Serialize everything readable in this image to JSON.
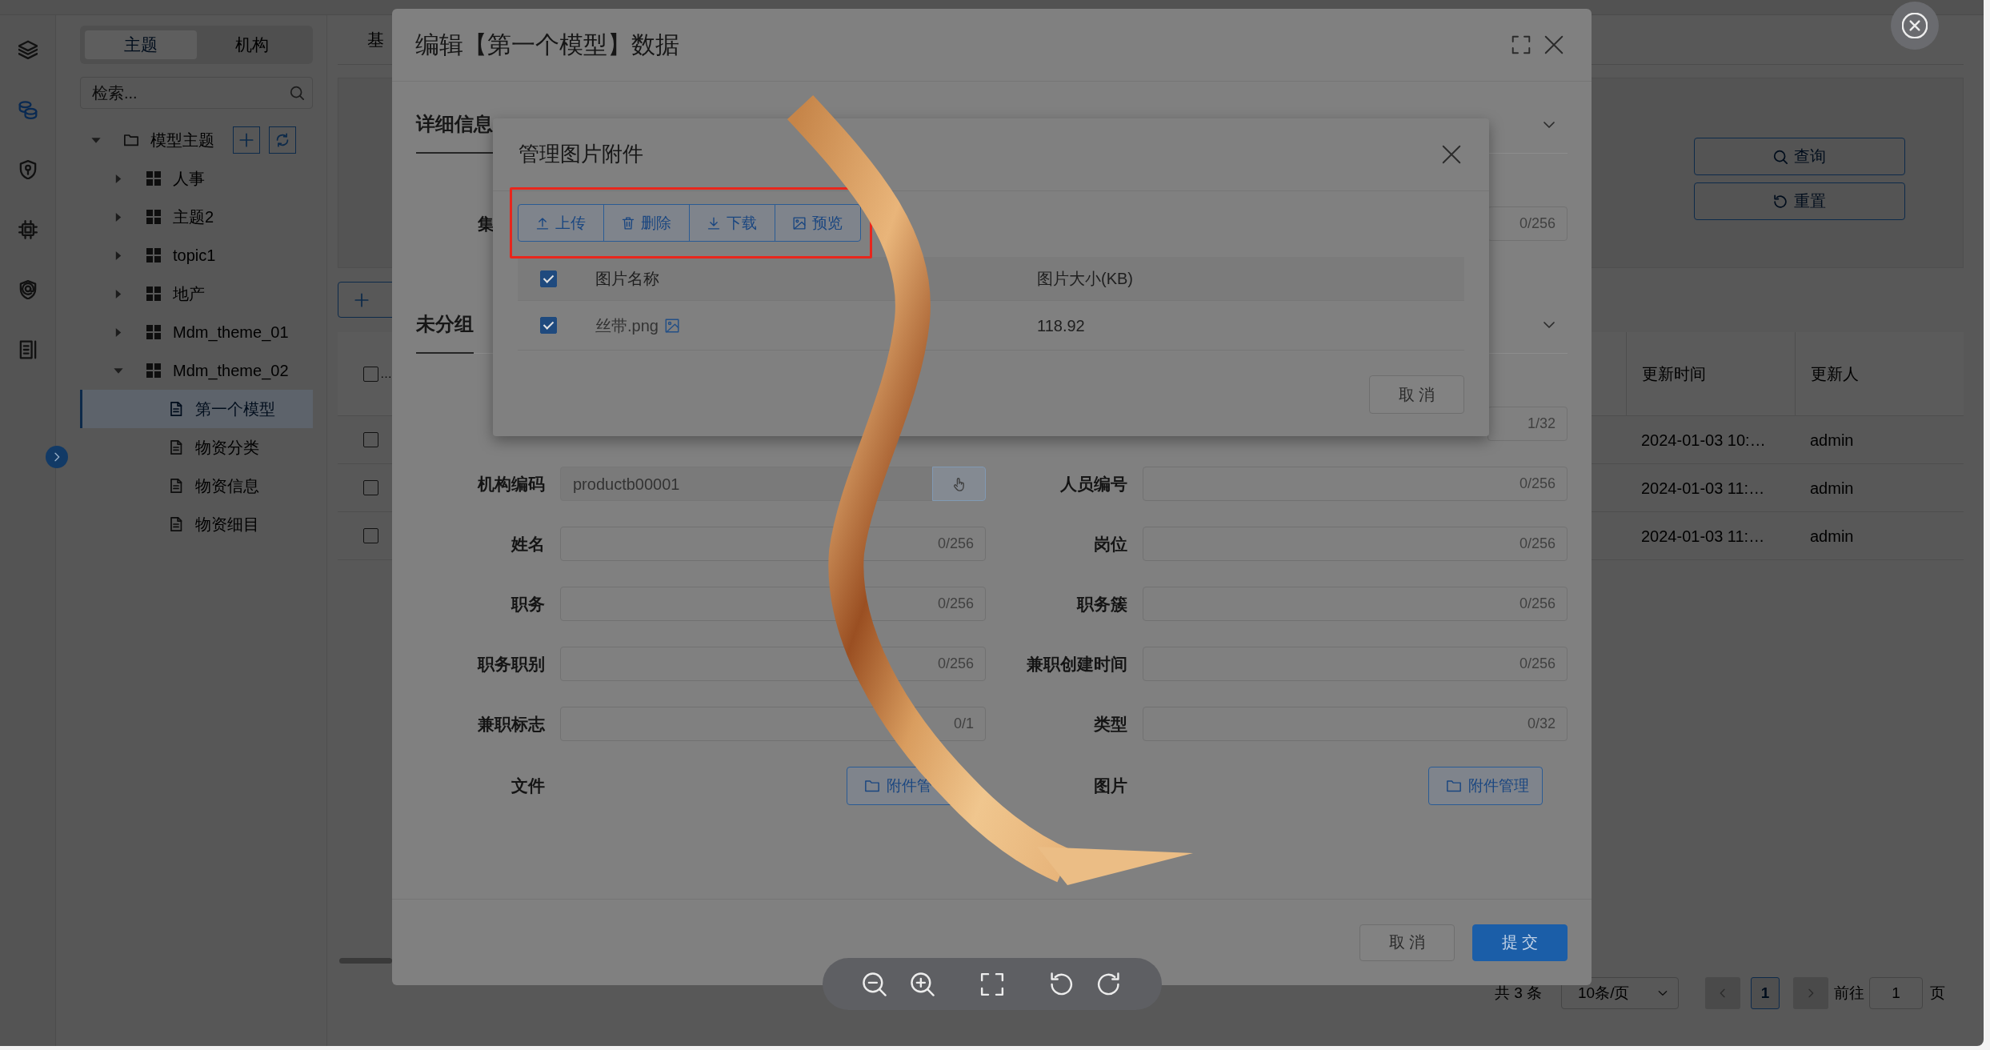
{
  "nav_rail": {
    "items": [
      {
        "selected": false
      },
      {
        "selected": true
      },
      {
        "selected": false
      },
      {
        "selected": false
      },
      {
        "selected": false
      },
      {
        "selected": false
      }
    ]
  },
  "sidebar": {
    "tabs": [
      {
        "label": "主题",
        "selected": true
      },
      {
        "label": "机构",
        "selected": false
      }
    ],
    "search": {
      "placeholder": "检索..."
    },
    "tree": [
      {
        "label": "模型主题",
        "selected": false,
        "expanded": true,
        "children": [
          {
            "label": "人事",
            "selected": false,
            "expanded": false
          },
          {
            "label": "主题2",
            "selected": false,
            "expanded": false
          },
          {
            "label": "topic1",
            "selected": false,
            "expanded": false
          },
          {
            "label": "地产",
            "selected": false,
            "expanded": false
          },
          {
            "label": "Mdm_theme_01",
            "selected": false,
            "expanded": false
          },
          {
            "label": "Mdm_theme_02",
            "selected": false,
            "expanded": true,
            "children": [
              {
                "label": "第一个模型",
                "selected": true
              },
              {
                "label": "物资分类",
                "selected": false
              },
              {
                "label": "物资信息",
                "selected": false
              },
              {
                "label": "物资细目",
                "selected": false
              }
            ]
          }
        ]
      }
    ]
  },
  "page": {
    "tab": {
      "label": "基"
    },
    "filter_buttons": [
      {
        "label": "查询"
      },
      {
        "label": "重置"
      }
    ],
    "table": {
      "select_all": {
        "checked": false
      },
      "columns": [
        "…",
        "更新时间",
        "更新人"
      ],
      "rows": [
        {
          "checked": false,
          "cells": [
            "",
            "2024-01-03 10:…",
            "admin"
          ]
        },
        {
          "checked": false,
          "cells": [
            "",
            "2024-01-03 11:…",
            "admin"
          ]
        },
        {
          "checked": false,
          "cells": [
            "",
            "2024-01-03 11:…",
            "admin"
          ]
        }
      ]
    },
    "pagination": {
      "total": "共 3 条",
      "page_size": "10条/页",
      "prev": {
        "disabled": true
      },
      "pages": [
        {
          "label": "1",
          "selected": true
        }
      ],
      "next": {
        "disabled": true
      },
      "jump_label": "前往",
      "jump_value": "1",
      "jump_suffix": "页"
    }
  },
  "modal": {
    "title": "编辑【第一个模型】数据",
    "sections": [
      {
        "title": "详细信息",
        "expanded": true,
        "rows": [
          {
            "left": {
              "label": "集"
            },
            "right": {
              "kind": "text",
              "counter": "0/256",
              "disabled": false
            }
          }
        ]
      },
      {
        "title": "未分组",
        "expanded": true,
        "rows": [
          {
            "right": {
              "kind": "text",
              "counter": "1/32",
              "disabled": false
            }
          },
          {
            "left": {
              "kind": "lookup",
              "label": "机构编码",
              "value": "productb00001",
              "disabled": true
            },
            "right": {
              "kind": "text",
              "label": "人员编号",
              "counter": "0/256",
              "disabled": false
            }
          },
          {
            "left": {
              "kind": "text",
              "label": "姓名",
              "counter": "0/256",
              "disabled": false
            },
            "right": {
              "kind": "text",
              "label": "岗位",
              "counter": "0/256",
              "disabled": false
            }
          },
          {
            "left": {
              "kind": "text",
              "label": "职务",
              "counter": "0/256",
              "disabled": false
            },
            "right": {
              "kind": "text",
              "label": "职务簇",
              "counter": "0/256",
              "disabled": false
            }
          },
          {
            "left": {
              "kind": "text",
              "label": "职务职别",
              "counter": "0/256",
              "disabled": false
            },
            "right": {
              "kind": "text",
              "label": "兼职创建时间",
              "counter": "0/256",
              "disabled": false
            }
          },
          {
            "left": {
              "kind": "text",
              "label": "兼职标志",
              "counter": "0/1",
              "disabled": false
            },
            "right": {
              "kind": "text",
              "label": "类型",
              "counter": "0/32",
              "disabled": false
            }
          },
          {
            "left": {
              "kind": "attachment",
              "label": "文件",
              "button": "附件管",
              "disabled": false
            },
            "right": {
              "kind": "attachment",
              "label": "图片",
              "button": "附件管理",
              "disabled": false
            }
          }
        ]
      }
    ],
    "footer": [
      {
        "label": "取 消",
        "kind": "default"
      },
      {
        "label": "提 交",
        "kind": "primary"
      }
    ]
  },
  "attachment_dialog": {
    "title": "管理图片附件",
    "toolbar": {
      "highlighted": true,
      "buttons": [
        {
          "label": "上传"
        },
        {
          "label": "删除"
        },
        {
          "label": "下载"
        },
        {
          "label": "预览"
        }
      ]
    },
    "table": {
      "select_all": {
        "checked": true
      },
      "columns": [
        "图片名称",
        "图片大小(KB)"
      ],
      "rows": [
        {
          "checked": true,
          "name": "丝带.png",
          "size": "118.92"
        }
      ]
    },
    "buttons": [
      {
        "label": "取 消"
      }
    ]
  }
}
